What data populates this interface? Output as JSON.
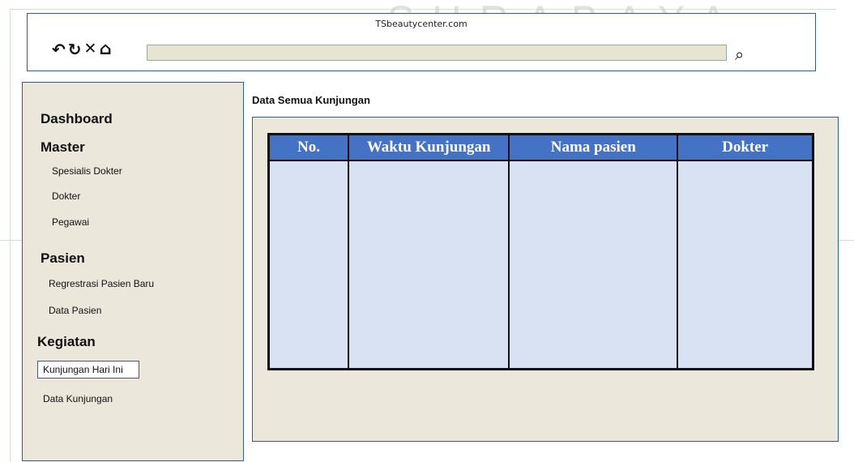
{
  "watermark": "SURABAYA",
  "browser": {
    "site_title": "TSbeautycenter.com",
    "nav_icons": [
      "undo-icon",
      "refresh-icon",
      "stop-icon",
      "home-icon"
    ],
    "url_value": "",
    "search_icon": "search-icon"
  },
  "sidebar": {
    "sections": [
      {
        "heading": "Dashboard",
        "items": []
      },
      {
        "heading": "Master",
        "items": [
          "Spesialis Dokter",
          "Dokter",
          "Pegawai"
        ]
      },
      {
        "heading": "Pasien",
        "items": [
          "Regrestrasi Pasien Baru",
          "Data Pasien"
        ]
      },
      {
        "heading": "Kegiatan",
        "items": [
          "Kunjungan Hari Ini",
          "Data Kunjungan"
        ]
      }
    ],
    "active_item": "Kunjungan Hari Ini"
  },
  "main": {
    "page_title": "Data Semua Kunjungan",
    "table": {
      "columns": [
        "No.",
        "Waktu Kunjungan",
        "Nama pasien",
        "Dokter"
      ],
      "rows": []
    }
  },
  "colors": {
    "accent": "#4472c4",
    "panel_bg": "#ebe7da",
    "table_cell_bg": "#d9e2f2",
    "frame_border": "#2f5d8a"
  }
}
